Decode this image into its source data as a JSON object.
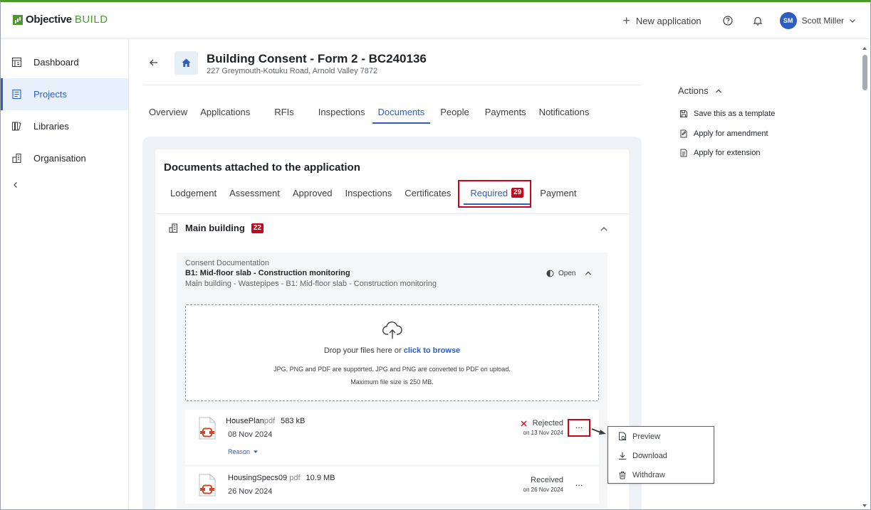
{
  "app": {
    "logo_bold": "Objective",
    "logo_light": "BUILD"
  },
  "topbar": {
    "new_application": "New application",
    "user_initials": "SM",
    "user_name": "Scott Miller"
  },
  "sidebar": {
    "items": [
      {
        "label": "Dashboard",
        "icon": "dashboard-icon"
      },
      {
        "label": "Projects",
        "icon": "projects-icon",
        "active": true
      },
      {
        "label": "Libraries",
        "icon": "libraries-icon"
      },
      {
        "label": "Organisation",
        "icon": "organisation-icon"
      }
    ]
  },
  "header": {
    "title": "Building Consent - Form 2 - BC240136",
    "address": "227 Greymouth-Kotuku Road, Arnold Valley 7872"
  },
  "tabs": [
    "Overview",
    "Applications",
    "RFIs",
    "Inspections",
    "Documents",
    "People",
    "Payments",
    "Notifications"
  ],
  "active_tab": "Documents",
  "documents": {
    "title": "Documents attached to the application",
    "subtabs": [
      "Lodgement",
      "Assessment",
      "Approved",
      "Inspections",
      "Certificates",
      "Required",
      "Payment"
    ],
    "required_count": "29",
    "section": {
      "title": "Main building",
      "count": "22"
    },
    "requirement": {
      "category": "Consent Documentation",
      "name": "B1: Mid-floor slab - Construction monitoring",
      "path": "Main building - Wastepipes - B1: Mid-floor slab - Construction monitoring",
      "status": "Open"
    },
    "dropzone": {
      "text": "Drop your files here or",
      "link": "click to browse",
      "note1": "JPG, PNG and PDF are supported. JPG and PNG are converted to PDF on upload.",
      "note2": "Maximum file size is 250 MB."
    },
    "files": [
      {
        "name": "HousePlan",
        "type": "pdf",
        "size": "583 kB",
        "date": "08 Nov 2024",
        "status": "Rejected",
        "status_date": "on 13 Nov 2024",
        "reason": "Reason"
      },
      {
        "name": "HousingSpecs09",
        "type": "pdf",
        "size": "10.9 MB",
        "date": "26 Nov 2024",
        "status": "Received",
        "status_date": "on 26 Nov 2024"
      }
    ],
    "more_label": "...",
    "menu": [
      "Preview",
      "Download",
      "Withdraw"
    ]
  },
  "actions": {
    "title": "Actions",
    "items": [
      "Save this as a template",
      "Apply for amendment",
      "Apply for extension"
    ]
  },
  "colors": {
    "brand_green": "#4c9a2a",
    "accent_blue": "#2d5fbf",
    "badge_red": "#c5091d",
    "highlight_red": "#d0021b"
  }
}
